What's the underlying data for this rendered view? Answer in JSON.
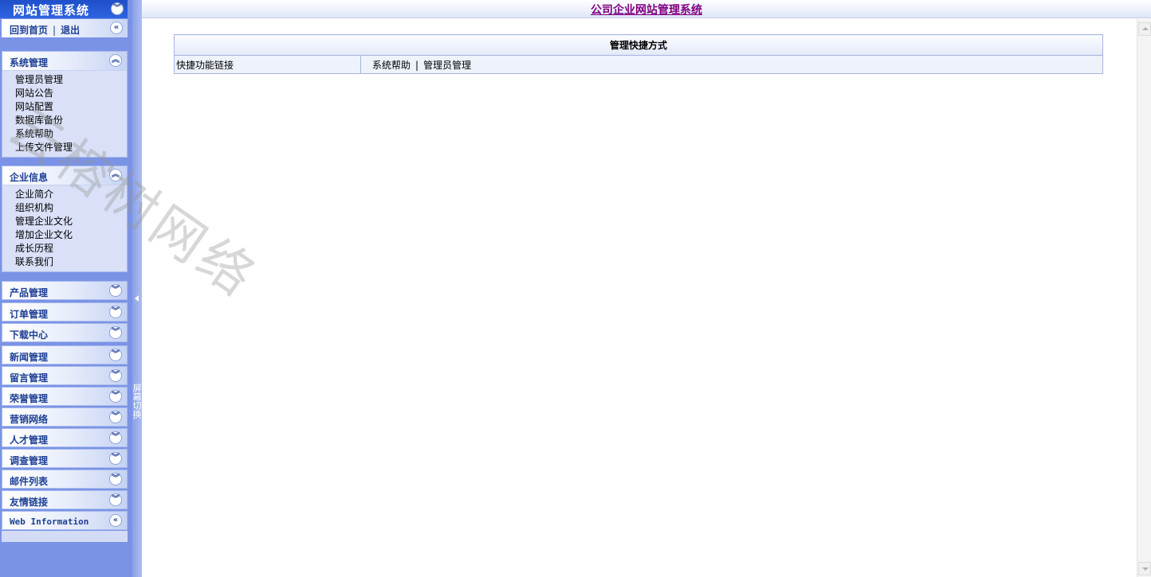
{
  "sidebar": {
    "title": "网站管理系统",
    "home_link": "回到首页",
    "separator": "|",
    "logout_link": "退出",
    "sections": [
      {
        "title": "系统管理",
        "items": [
          "管理员管理",
          "网站公告",
          "网站配置",
          "数据库备份",
          "系统帮助",
          "上传文件管理"
        ]
      },
      {
        "title": "企业信息",
        "items": [
          "企业简介",
          "组织机构",
          "管理企业文化",
          "增加企业文化",
          "成长历程",
          "联系我们"
        ]
      }
    ],
    "collapsed": [
      "产品管理",
      "订单管理",
      "下载中心",
      "新闻管理",
      "留言管理",
      "荣誉管理",
      "营销网络",
      "人才管理",
      "调查管理",
      "邮件列表",
      "友情链接",
      "Web Information"
    ]
  },
  "splitter": {
    "label": "屏幕切换"
  },
  "header": {
    "title": "公司企业网站管理系统"
  },
  "quick_table": {
    "heading": "管理快捷方式",
    "row_label": "快捷功能链接",
    "link_help": "系统帮助",
    "link_sep": "|",
    "link_admin": "管理员管理"
  },
  "watermark": {
    "text": "云榕树网络"
  },
  "icons": {
    "collapse_up": "double-chevron-up-icon",
    "expand_down": "double-chevron-down-icon",
    "collapse_left": "double-chevron-left-icon"
  },
  "colors": {
    "sidebar_bg": "#7b93e6",
    "menu_label": "#1d3f94",
    "header_title": "#800080",
    "table_border": "#a4b5dd"
  }
}
